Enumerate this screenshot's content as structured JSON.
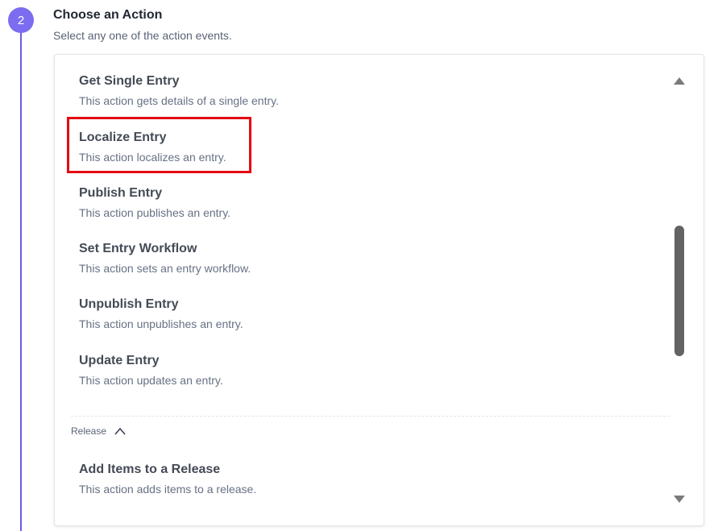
{
  "step": {
    "number": "2",
    "title": "Choose an Action",
    "subtitle": "Select any one of the action events."
  },
  "actions": [
    {
      "name": "Get Single Entry",
      "description": "This action gets details of a single entry."
    },
    {
      "name": "Localize Entry",
      "description": "This action localizes an entry.",
      "highlighted": true
    },
    {
      "name": "Publish Entry",
      "description": "This action publishes an entry."
    },
    {
      "name": "Set Entry Workflow",
      "description": "This action sets an entry workflow."
    },
    {
      "name": "Unpublish Entry",
      "description": "This action unpublishes an entry."
    },
    {
      "name": "Update Entry",
      "description": "This action updates an entry."
    }
  ],
  "release_group": {
    "label": "Release",
    "icon": "chevron-up-icon",
    "actions": [
      {
        "name": "Add Items to a Release",
        "description": "This action adds items to a release."
      }
    ]
  },
  "colors": {
    "accent": "#7b6cf0",
    "highlight": "#e50914"
  }
}
